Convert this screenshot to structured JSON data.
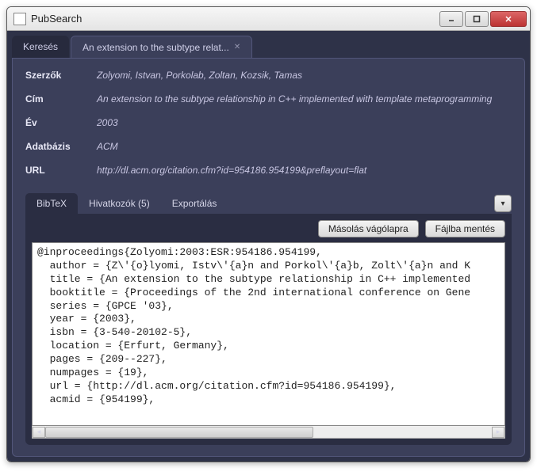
{
  "window": {
    "title": "PubSearch"
  },
  "tabs": {
    "search": "Keresés",
    "detail": "An extension to the subtype relat..."
  },
  "meta": {
    "labels": {
      "authors": "Szerzők",
      "title": "Cím",
      "year": "Év",
      "database": "Adatbázis",
      "url": "URL"
    },
    "values": {
      "authors": "Zolyomi, Istvan, Porkolab, Zoltan, Kozsik, Tamas",
      "title": "An extension to the subtype relationship in C++ implemented with template metaprogramming",
      "year": "2003",
      "database": "ACM",
      "url": "http://dl.acm.org/citation.cfm?id=954186.954199&preflayout=flat"
    }
  },
  "subtabs": {
    "bibtex": "BibTeX",
    "refs": "Hivatkozók (5)",
    "export": "Exportálás"
  },
  "buttons": {
    "copy": "Másolás vágólapra",
    "save": "Fájlba mentés"
  },
  "bibtex": "@inproceedings{Zolyomi:2003:ESR:954186.954199,\n  author = {Z\\'{o}lyomi, Istv\\'{a}n and Porkol\\'{a}b, Zolt\\'{a}n and K\n  title = {An extension to the subtype relationship in C++ implemented\n  booktitle = {Proceedings of the 2nd international conference on Gene\n  series = {GPCE '03},\n  year = {2003},\n  isbn = {3-540-20102-5},\n  location = {Erfurt, Germany},\n  pages = {209--227},\n  numpages = {19},\n  url = {http://dl.acm.org/citation.cfm?id=954186.954199},\n  acmid = {954199},"
}
